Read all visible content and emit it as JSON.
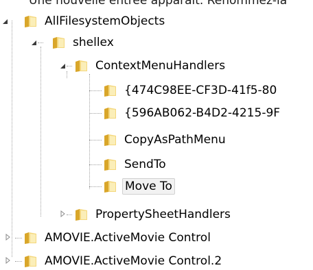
{
  "top_caption": "Une nouvelle entrée apparaît. Renommez-la",
  "tree": {
    "items": [
      {
        "label": "AllFilesystemObjects",
        "icon": "folder-icon",
        "expander": "expanded"
      },
      {
        "label": "shellex",
        "icon": "folder-icon",
        "expander": "expanded"
      },
      {
        "label": "ContextMenuHandlers",
        "icon": "folder-icon",
        "expander": "expanded"
      },
      {
        "label": "{474C98EE-CF3D-41f5-80",
        "icon": "folder-icon",
        "expander": "none"
      },
      {
        "label": "{596AB062-B4D2-4215-9F",
        "icon": "folder-icon",
        "expander": "none"
      },
      {
        "label": "CopyAsPathMenu",
        "icon": "folder-icon",
        "expander": "none"
      },
      {
        "label": "SendTo",
        "icon": "folder-icon",
        "expander": "none"
      },
      {
        "label": "Move To",
        "icon": "folder-icon",
        "expander": "none",
        "selected": true
      },
      {
        "label": "PropertySheetHandlers",
        "icon": "folder-icon",
        "expander": "collapsed"
      },
      {
        "label": "AMOVIE.ActiveMovie Control",
        "icon": "folder-icon",
        "expander": "collapsed"
      },
      {
        "label": "AMOVIE.ActiveMovie Control.2",
        "icon": "folder-icon",
        "expander": "collapsed"
      }
    ]
  }
}
